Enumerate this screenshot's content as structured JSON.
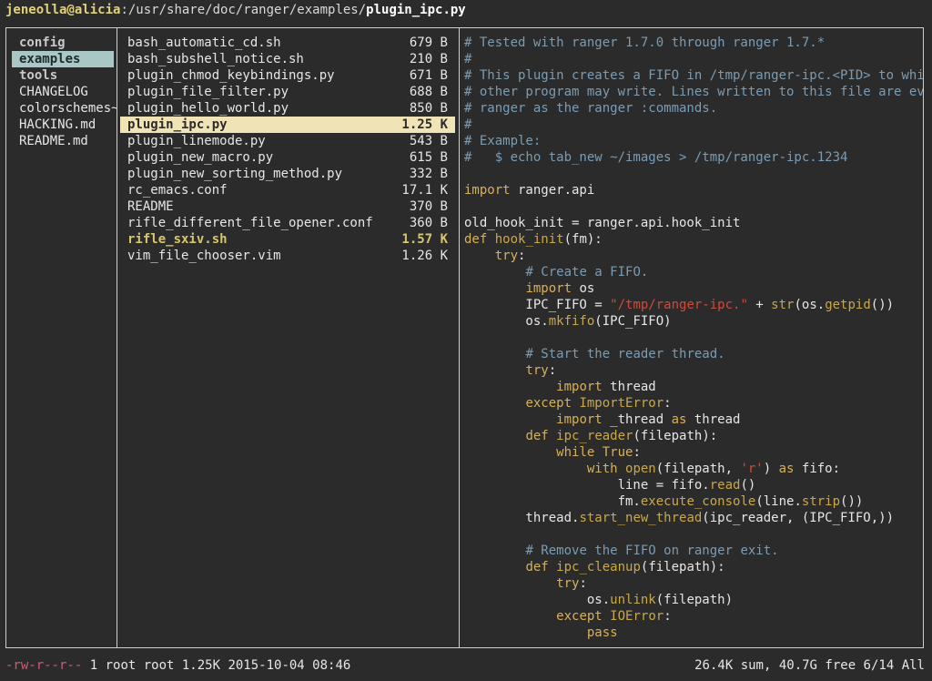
{
  "title": {
    "user": "jeneolla@alicia",
    "path": ":/usr/share/doc/ranger/examples/",
    "file": "plugin_ipc.py"
  },
  "left": {
    "items": [
      {
        "label": "config"
      },
      {
        "label": "examples"
      },
      {
        "label": "tools"
      },
      {
        "label": "CHANGELOG"
      },
      {
        "label": "colorschemes~"
      },
      {
        "label": "HACKING.md"
      },
      {
        "label": "README.md"
      }
    ]
  },
  "middle": {
    "files": [
      {
        "name": "bash_automatic_cd.sh",
        "size": "679 B"
      },
      {
        "name": "bash_subshell_notice.sh",
        "size": "210 B"
      },
      {
        "name": "plugin_chmod_keybindings.py",
        "size": "671 B"
      },
      {
        "name": "plugin_file_filter.py",
        "size": "688 B"
      },
      {
        "name": "plugin_hello_world.py",
        "size": "850 B"
      },
      {
        "name": "plugin_ipc.py",
        "size": "1.25 K"
      },
      {
        "name": "plugin_linemode.py",
        "size": "543 B"
      },
      {
        "name": "plugin_new_macro.py",
        "size": "615 B"
      },
      {
        "name": "plugin_new_sorting_method.py",
        "size": "332 B"
      },
      {
        "name": "rc_emacs.conf",
        "size": "17.1 K"
      },
      {
        "name": "README",
        "size": "370 B"
      },
      {
        "name": "rifle_different_file_opener.conf",
        "size": "360 B"
      },
      {
        "name": "rifle_sxiv.sh",
        "size": "1.57 K"
      },
      {
        "name": "vim_file_chooser.vim",
        "size": "1.26 K"
      }
    ]
  },
  "preview": {
    "lines": [
      [
        [
          "c",
          "# Tested with ranger 1.7.0 through ranger 1.7.*"
        ]
      ],
      [
        [
          "c",
          "#"
        ]
      ],
      [
        [
          "c",
          "# This plugin creates a FIFO in /tmp/ranger-ipc.<PID> to which"
        ]
      ],
      [
        [
          "c",
          "# other program may write. Lines written to this file are evalu"
        ]
      ],
      [
        [
          "c",
          "# ranger as the ranger :commands."
        ]
      ],
      [
        [
          "c",
          "#"
        ]
      ],
      [
        [
          "c",
          "# Example:"
        ]
      ],
      [
        [
          "c",
          "#   $ echo tab_new ~/images > /tmp/ranger-ipc.1234"
        ]
      ],
      [
        [
          "n",
          ""
        ]
      ],
      [
        [
          "k",
          "import"
        ],
        [
          "n",
          " ranger.api"
        ]
      ],
      [
        [
          "n",
          ""
        ]
      ],
      [
        [
          "n",
          "old_hook_init = ranger.api.hook_init"
        ]
      ],
      [
        [
          "k",
          "def"
        ],
        [
          "n",
          " "
        ],
        [
          "f",
          "hook_init"
        ],
        [
          "n",
          "(fm):"
        ]
      ],
      [
        [
          "n",
          "    "
        ],
        [
          "k",
          "try"
        ],
        [
          "n",
          ":"
        ]
      ],
      [
        [
          "n",
          "        "
        ],
        [
          "c",
          "# Create a FIFO."
        ]
      ],
      [
        [
          "n",
          "        "
        ],
        [
          "k",
          "import"
        ],
        [
          "n",
          " os"
        ]
      ],
      [
        [
          "n",
          "        IPC_FIFO = "
        ],
        [
          "s",
          "\"/tmp/ranger-ipc.\""
        ],
        [
          "n",
          " + "
        ],
        [
          "f",
          "str"
        ],
        [
          "n",
          "(os."
        ],
        [
          "f",
          "getpid"
        ],
        [
          "n",
          "())"
        ]
      ],
      [
        [
          "n",
          "        os."
        ],
        [
          "f",
          "mkfifo"
        ],
        [
          "n",
          "(IPC_FIFO)"
        ]
      ],
      [
        [
          "n",
          ""
        ]
      ],
      [
        [
          "n",
          "        "
        ],
        [
          "c",
          "# Start the reader thread."
        ]
      ],
      [
        [
          "n",
          "        "
        ],
        [
          "k",
          "try"
        ],
        [
          "n",
          ":"
        ]
      ],
      [
        [
          "n",
          "            "
        ],
        [
          "k",
          "import"
        ],
        [
          "n",
          " thread"
        ]
      ],
      [
        [
          "n",
          "        "
        ],
        [
          "k",
          "except"
        ],
        [
          "n",
          " "
        ],
        [
          "f",
          "ImportError"
        ],
        [
          "n",
          ":"
        ]
      ],
      [
        [
          "n",
          "            "
        ],
        [
          "k",
          "import"
        ],
        [
          "n",
          " _thread "
        ],
        [
          "k",
          "as"
        ],
        [
          "n",
          " thread"
        ]
      ],
      [
        [
          "n",
          "        "
        ],
        [
          "k",
          "def"
        ],
        [
          "n",
          " "
        ],
        [
          "f",
          "ipc_reader"
        ],
        [
          "n",
          "(filepath):"
        ]
      ],
      [
        [
          "n",
          "            "
        ],
        [
          "k",
          "while"
        ],
        [
          "n",
          " "
        ],
        [
          "k",
          "True"
        ],
        [
          "n",
          ":"
        ]
      ],
      [
        [
          "n",
          "                "
        ],
        [
          "k",
          "with"
        ],
        [
          "n",
          " "
        ],
        [
          "f",
          "open"
        ],
        [
          "n",
          "(filepath, "
        ],
        [
          "s",
          "'r'"
        ],
        [
          "n",
          ") "
        ],
        [
          "k",
          "as"
        ],
        [
          "n",
          " fifo:"
        ]
      ],
      [
        [
          "n",
          "                    line = fifo."
        ],
        [
          "f",
          "read"
        ],
        [
          "n",
          "()"
        ]
      ],
      [
        [
          "n",
          "                    fm."
        ],
        [
          "f",
          "execute_console"
        ],
        [
          "n",
          "(line."
        ],
        [
          "f",
          "strip"
        ],
        [
          "n",
          "())"
        ]
      ],
      [
        [
          "n",
          "        thread."
        ],
        [
          "f",
          "start_new_thread"
        ],
        [
          "n",
          "(ipc_reader, (IPC_FIFO,))"
        ]
      ],
      [
        [
          "n",
          ""
        ]
      ],
      [
        [
          "n",
          "        "
        ],
        [
          "c",
          "# Remove the FIFO on ranger exit."
        ]
      ],
      [
        [
          "n",
          "        "
        ],
        [
          "k",
          "def"
        ],
        [
          "n",
          " "
        ],
        [
          "f",
          "ipc_cleanup"
        ],
        [
          "n",
          "(filepath):"
        ]
      ],
      [
        [
          "n",
          "            "
        ],
        [
          "k",
          "try"
        ],
        [
          "n",
          ":"
        ]
      ],
      [
        [
          "n",
          "                os."
        ],
        [
          "f",
          "unlink"
        ],
        [
          "n",
          "(filepath)"
        ]
      ],
      [
        [
          "n",
          "            "
        ],
        [
          "k",
          "except"
        ],
        [
          "n",
          " "
        ],
        [
          "f",
          "IOError"
        ],
        [
          "n",
          ":"
        ]
      ],
      [
        [
          "n",
          "                "
        ],
        [
          "k",
          "pass"
        ]
      ]
    ]
  },
  "status": {
    "perm": "-rw-r--r--",
    "info": " 1 root root 1.25K 2015-10-04 08:46",
    "right": "26.4K sum, 40.7G free  6/14  All"
  },
  "colors": {
    "background": "#2b2b2b",
    "selection": "#f0e3b6",
    "dir_selection": "#a9c7c4",
    "comment": "#7b9cb3",
    "keyword": "#d6b15c",
    "string": "#d04b3b",
    "permissions": "#d15a78"
  }
}
